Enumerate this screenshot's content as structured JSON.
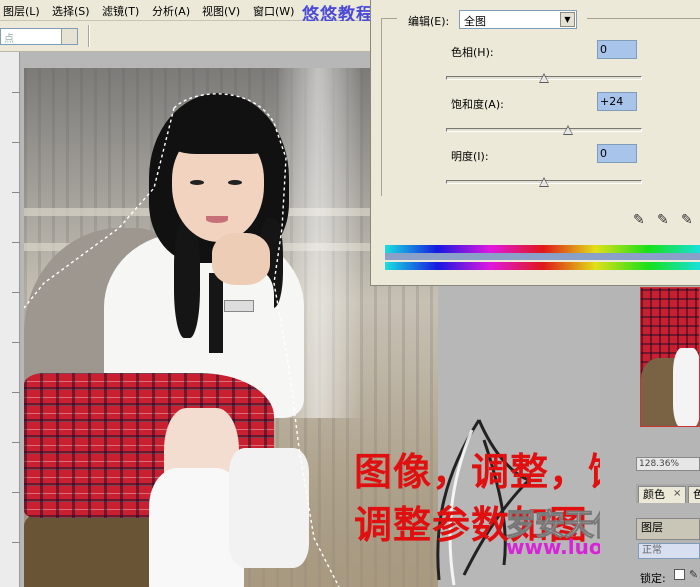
{
  "menu": {
    "items": [
      "图层(L)",
      "选择(S)",
      "滤镜(T)",
      "分析(A)",
      "视图(V)",
      "窗口(W)"
    ]
  },
  "tutorial_title": "悠悠教程",
  "options_bar": {
    "combo_value": "点"
  },
  "dialog": {
    "edit_label": "编辑(E):",
    "edit_value": "全图",
    "hue": {
      "label": "色相(H):",
      "value": "0",
      "level": 0.5
    },
    "saturation": {
      "label": "饱和度(A):",
      "value": "+24",
      "level": 0.62
    },
    "lightness": {
      "label": "明度(I):",
      "value": "0",
      "level": 0.5
    },
    "icons": [
      "eyedropper-icon",
      "eyedropper-plus-icon",
      "eyedropper-minus-icon"
    ]
  },
  "overlay": {
    "caption_line1": "图像，调整，饱和度",
    "caption_line2": "调整参数如图",
    "watermark_site": "罗安天使论坛",
    "watermark_url": "www.luoan.cn"
  },
  "right_panel": {
    "zoom": "128.36%",
    "tab_color": "颜色",
    "tab_color_close": "×",
    "tab_second": "色",
    "layers_tab": "图层",
    "blend_mode": "正常",
    "lock_label": "锁定:"
  },
  "colors": {
    "caption": "#e01010",
    "watermark_url": "#d824d8",
    "title": "#4a4ad8",
    "value_field": "#a9c4ea"
  }
}
